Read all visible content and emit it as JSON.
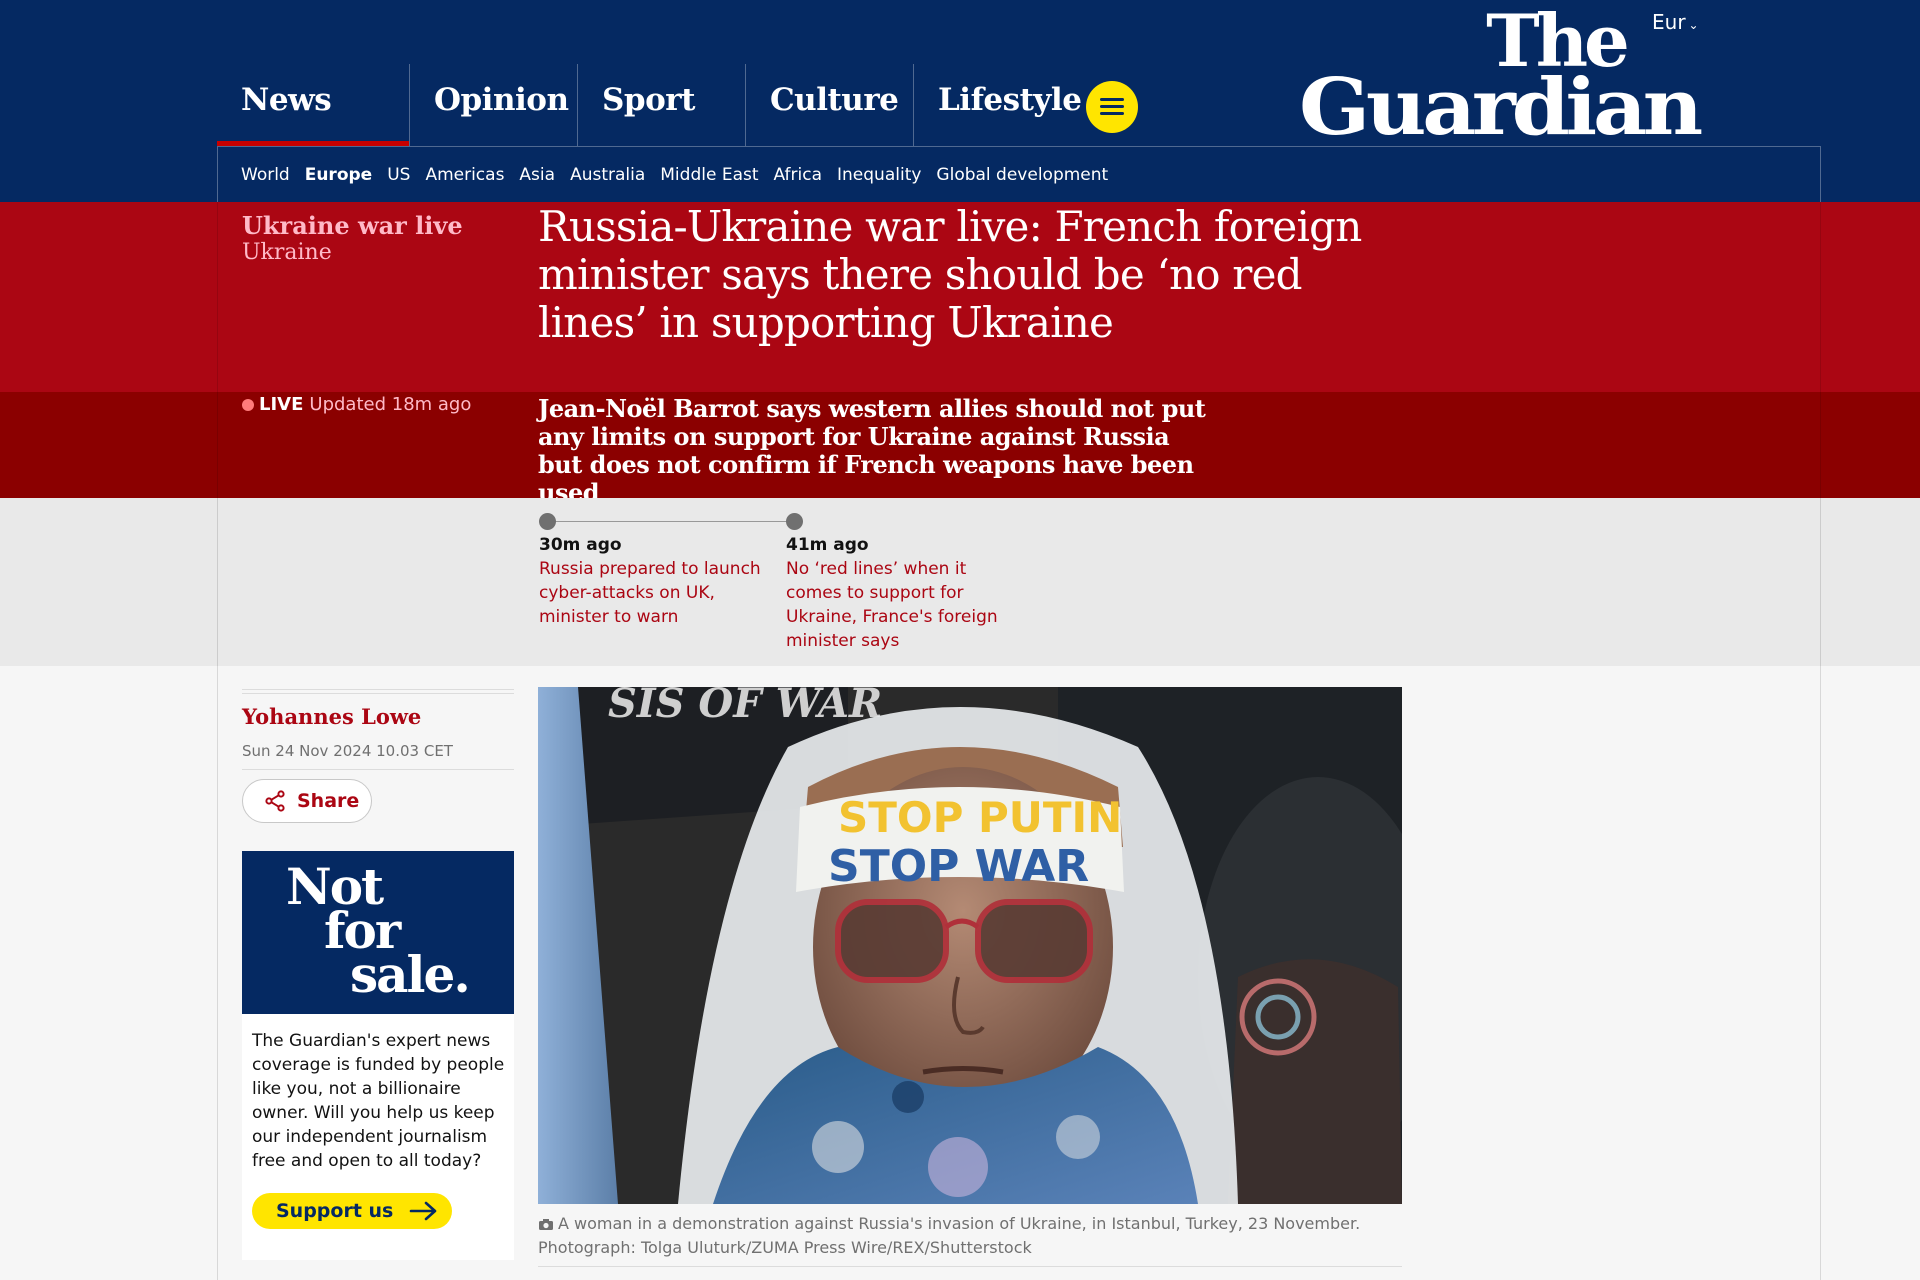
{
  "header": {
    "edition": "Eur",
    "logo_line1": "The",
    "logo_line2": "Guardian",
    "pillars": [
      "News",
      "Opinion",
      "Sport",
      "Culture",
      "Lifestyle"
    ],
    "subnav": [
      "World",
      "Europe",
      "US",
      "Americas",
      "Asia",
      "Australia",
      "Middle East",
      "Africa",
      "Inequality",
      "Global development"
    ],
    "colors": {
      "brand": "#052962",
      "news_red": "#ab0613",
      "dark_red": "#8b0000",
      "yellow": "#ffe500"
    }
  },
  "article": {
    "kicker": "Ukraine war live",
    "kicker_sub": "Ukraine",
    "headline": "Russia-Ukraine war live: French foreign minister says there should be ‘no red lines’ in supporting Ukraine",
    "live_label": "LIVE",
    "updated": "Updated 18m ago",
    "standfirst": "Jean-Noël Barrot says western allies should not put any limits on support for Ukraine against Russia but does not confirm if French weapons have been used"
  },
  "key_events": [
    {
      "time": "30m ago",
      "text": "Russia prepared to launch cyber-attacks on UK, minister to warn"
    },
    {
      "time": "41m ago",
      "text": "No ‘red lines’ when it comes to support for Ukraine, France's foreign minister says"
    }
  ],
  "byline": {
    "author": "Yohannes Lowe",
    "date": "Sun 24 Nov 2024 10.03 CET",
    "share_label": "Share"
  },
  "support": {
    "nfs_1": "Not",
    "nfs_2": "for",
    "nfs_3": "sale.",
    "body": "The Guardian's expert news coverage is funded by people like you, not a billionaire owner. Will you help us keep our independent journalism free and open to all today?",
    "button": "Support us"
  },
  "photo": {
    "headband_text_1": "STOP PUTIN",
    "headband_text_2": "STOP WAR",
    "sign_text": "SIS OF WAR",
    "caption": "A woman in a demonstration against Russia's invasion of Ukraine, in Istanbul, Turkey, 23 November. Photograph: Tolga Uluturk/ZUMA Press Wire/REX/Shutterstock"
  }
}
